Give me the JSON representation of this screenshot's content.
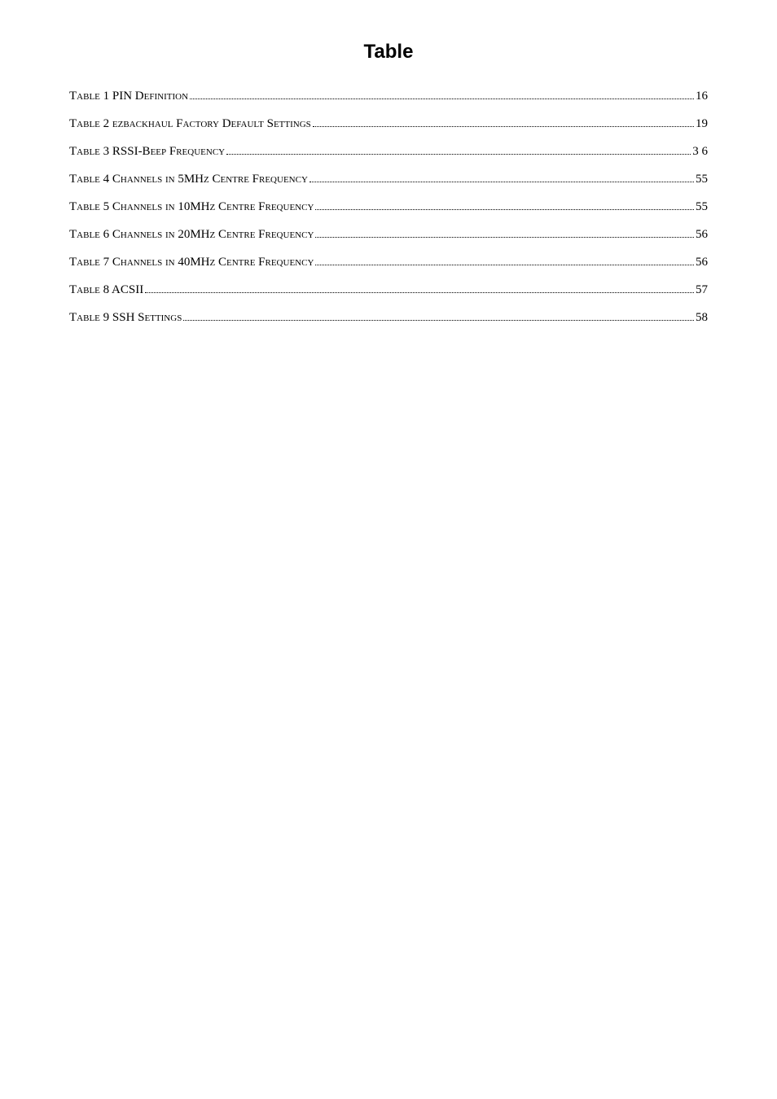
{
  "title": "Table",
  "entries": [
    {
      "label": "Table 1 PIN Definition",
      "page": "16"
    },
    {
      "label": "Table 2 ezbackhaul Factory Default Settings",
      "page": "19"
    },
    {
      "label": "Table 3 RSSI-Beep Frequency",
      "page": "3 6"
    },
    {
      "label": "Table 4 Channels in 5MHz Centre Frequency",
      "page": "55"
    },
    {
      "label": "Table 5 Channels in 10MHz Centre Frequency",
      "page": "55"
    },
    {
      "label": "Table 6 Channels in 20MHz Centre Frequency",
      "page": "56"
    },
    {
      "label": "Table 7 Channels in 40MHz Centre Frequency",
      "page": "56"
    },
    {
      "label": "Table 8 ACSII",
      "page": "57"
    },
    {
      "label": "Table 9 SSH Settings",
      "page": "58"
    }
  ]
}
